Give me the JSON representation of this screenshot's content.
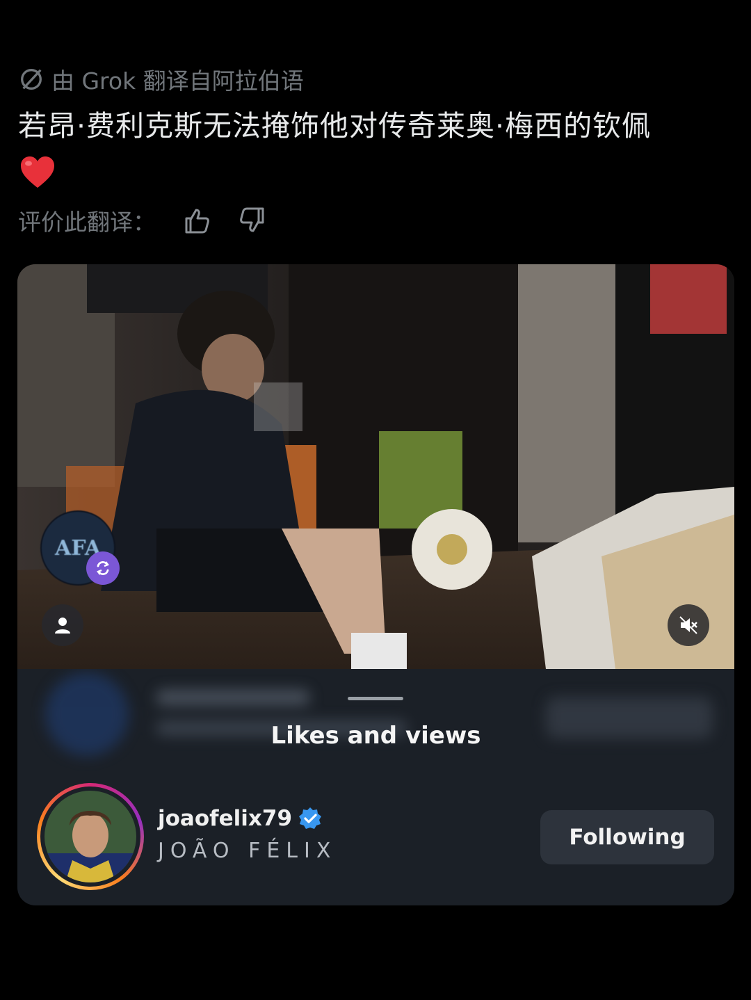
{
  "translation": {
    "label": "由 Grok 翻译自阿拉伯语",
    "icon": "grok-icon"
  },
  "post": {
    "text": "若昂·费利克斯无法掩饰他对传奇莱奥·梅西的钦佩",
    "emoji": "heart-emoji"
  },
  "rating": {
    "label": "评价此翻译：",
    "thumbs_up_icon": "thumbs-up-icon",
    "thumbs_down_icon": "thumbs-down-icon"
  },
  "video": {
    "badge_text": "AFA",
    "repost_icon": "repost-icon",
    "user_tag_icon": "person-icon",
    "mute_icon": "speaker-muted-icon"
  },
  "likes_sheet": {
    "title": "Likes and views",
    "user": {
      "username": "joaofelix79",
      "display_name": "JOÃO FÉLIX",
      "verified": true,
      "follow_button": "Following"
    },
    "colors": {
      "sheet_bg": "#1b2027",
      "button_bg": "#2d333c",
      "verified_blue": "#3897f0"
    }
  }
}
